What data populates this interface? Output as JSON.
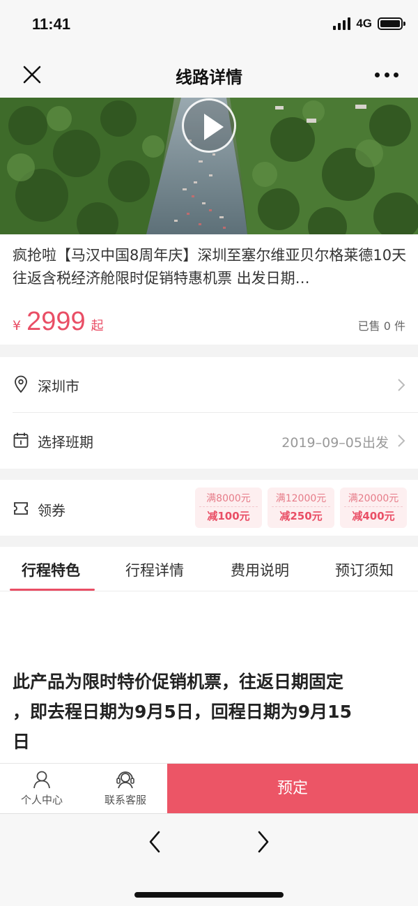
{
  "status": {
    "time": "11:41",
    "network": "4G"
  },
  "nav": {
    "title": "线路详情"
  },
  "product": {
    "title": "疯抢啦【马汉中国8周年庆】深圳至塞尔维亚贝尔格莱德10天往返含税经济舱限时促销特惠机票 出发日期…",
    "price_symbol": "¥",
    "price": "2999",
    "price_suffix": "起",
    "sold": "已售 0 件"
  },
  "location": {
    "label": "深圳市"
  },
  "schedule": {
    "label": "选择班期",
    "value": "2019–09–05出发"
  },
  "coupon": {
    "label": "领券",
    "items": [
      {
        "condition": "满8000元",
        "discount": "减100元"
      },
      {
        "condition": "满12000元",
        "discount": "减250元"
      },
      {
        "condition": "满20000元",
        "discount": "减400元"
      }
    ]
  },
  "tabs": [
    {
      "label": "行程特色"
    },
    {
      "label": "行程详情"
    },
    {
      "label": "费用说明"
    },
    {
      "label": "预订须知"
    }
  ],
  "content": {
    "line1": "此产品为限时特价促销机票，往返日期固定",
    "line2": "，即去程日期为9月5日，回程日期为9月15",
    "line3": "日"
  },
  "bottom_bar": {
    "profile_label": "个人中心",
    "service_label": "联系客服",
    "book_label": "预定"
  },
  "colors": {
    "accent": "#ec5566",
    "price": "#e94e65"
  }
}
